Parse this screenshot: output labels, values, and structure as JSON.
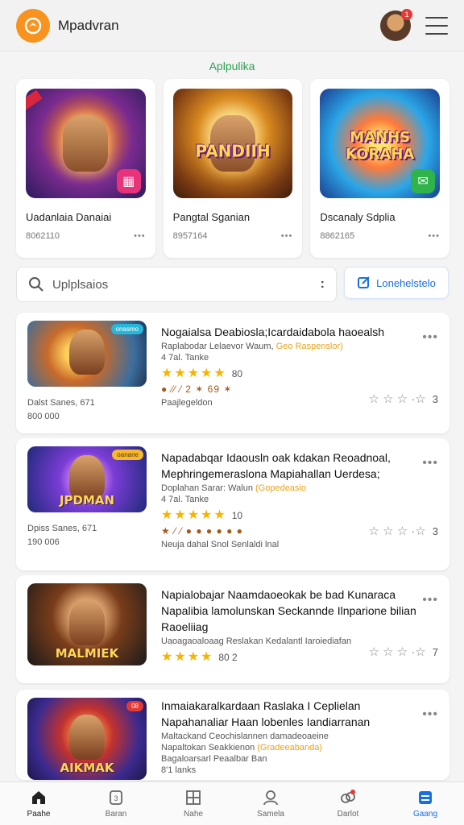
{
  "app": {
    "brand": "Mpadvran",
    "section_title": "Aplpulika",
    "avatar_badge": "1"
  },
  "colors": {
    "accent": "#1a6fe0",
    "logo": "#f7931e",
    "section": "#2e9e4f",
    "star": "#f5b400"
  },
  "featured": [
    {
      "title": "Uadanlaia Danaiai",
      "meta": "8062110",
      "badge_icon": "grid-icon"
    },
    {
      "title": "Pangtal Sganian",
      "meta": "8957164",
      "image_text": "PANDIIH"
    },
    {
      "title": "Dscanaly Sdplia",
      "meta": "8862165",
      "image_text": "MANHS KORAHA",
      "badge_icon": "chat-icon"
    }
  ],
  "search": {
    "placeholder": "Uplplsaios",
    "more": ":"
  },
  "filter_button": {
    "label": "Lonehelstelo"
  },
  "items": [
    {
      "title": "Nogaialsa Deabiosla;Icardaidabola haoealsh",
      "line1": "Raplabodar Lelaevor Waum, ",
      "line1_highlight": "Geo Raspenslor)",
      "line2": "4 7al. Tanke",
      "stars": "★★★★★",
      "count": "80",
      "emojis": "● ⁄⁄ ⁄ 2 ✶ 69 ✶",
      "footer": "Paajlegeldon",
      "left1": "Dalst Sanes, 671",
      "left2": "800 000",
      "thumb_tag": "onasmo",
      "rating_num": "3"
    },
    {
      "title": "Napadabqar Idaousln oak kdakan Reoadnoal, Mephringemeraslona Mapiahallan Uerdesa;",
      "line1": "Doplahan Sarar: Walun ",
      "line1_highlight": "(Gopedeasio",
      "line2": "4 7al. Tanke",
      "stars": "★★★★★",
      "count": "10",
      "emojis": "★ ⁄ ⁄ ● ● ● ● ● ●",
      "footer": "Neuja dahal Snol Senlaldi lnal",
      "left1": "Dpiss Sanes, 671",
      "left2": "190 006",
      "thumb_tag": "oanane",
      "thumb_text": "JPDMAN",
      "rating_num": "3"
    },
    {
      "title": "Napialobajar Naamdaoeokak be bad Kunaraca Napalibia lamolunskan Seckannde Ilnparione bilian Raoeliiag",
      "line1": "Uaoagaoaloaag Reslakan Kedalantl Iaroiediafan",
      "stars": "★★★★",
      "count": "80 2",
      "thumb_text": "MALMIEK",
      "rating_num": "7"
    },
    {
      "title": "Inmaiakaralkardaan Raslaka I Ceplielan Napahanaliar Haan lobenles Iandiarranan",
      "line1": "Maltackand Ceochislannen damadeoaeine",
      "line2a": "Napaltokan Seakkienon ",
      "line2_highlight": "(Gradeeabanda)",
      "line3": "Bagaloarsarl Peaalbar Ban",
      "line4": "8'1 lanks",
      "thumb_tag": "08",
      "thumb_text": "AIKMAK"
    }
  ],
  "nav": [
    {
      "label": "Paahe",
      "icon": "home-icon"
    },
    {
      "label": "Baran",
      "icon": "badge-icon"
    },
    {
      "label": "Nahe",
      "icon": "grid-icon"
    },
    {
      "label": "Samela",
      "icon": "user-icon"
    },
    {
      "label": "Darlot",
      "icon": "group-icon"
    },
    {
      "label": "Gaang",
      "icon": "list-icon"
    }
  ]
}
